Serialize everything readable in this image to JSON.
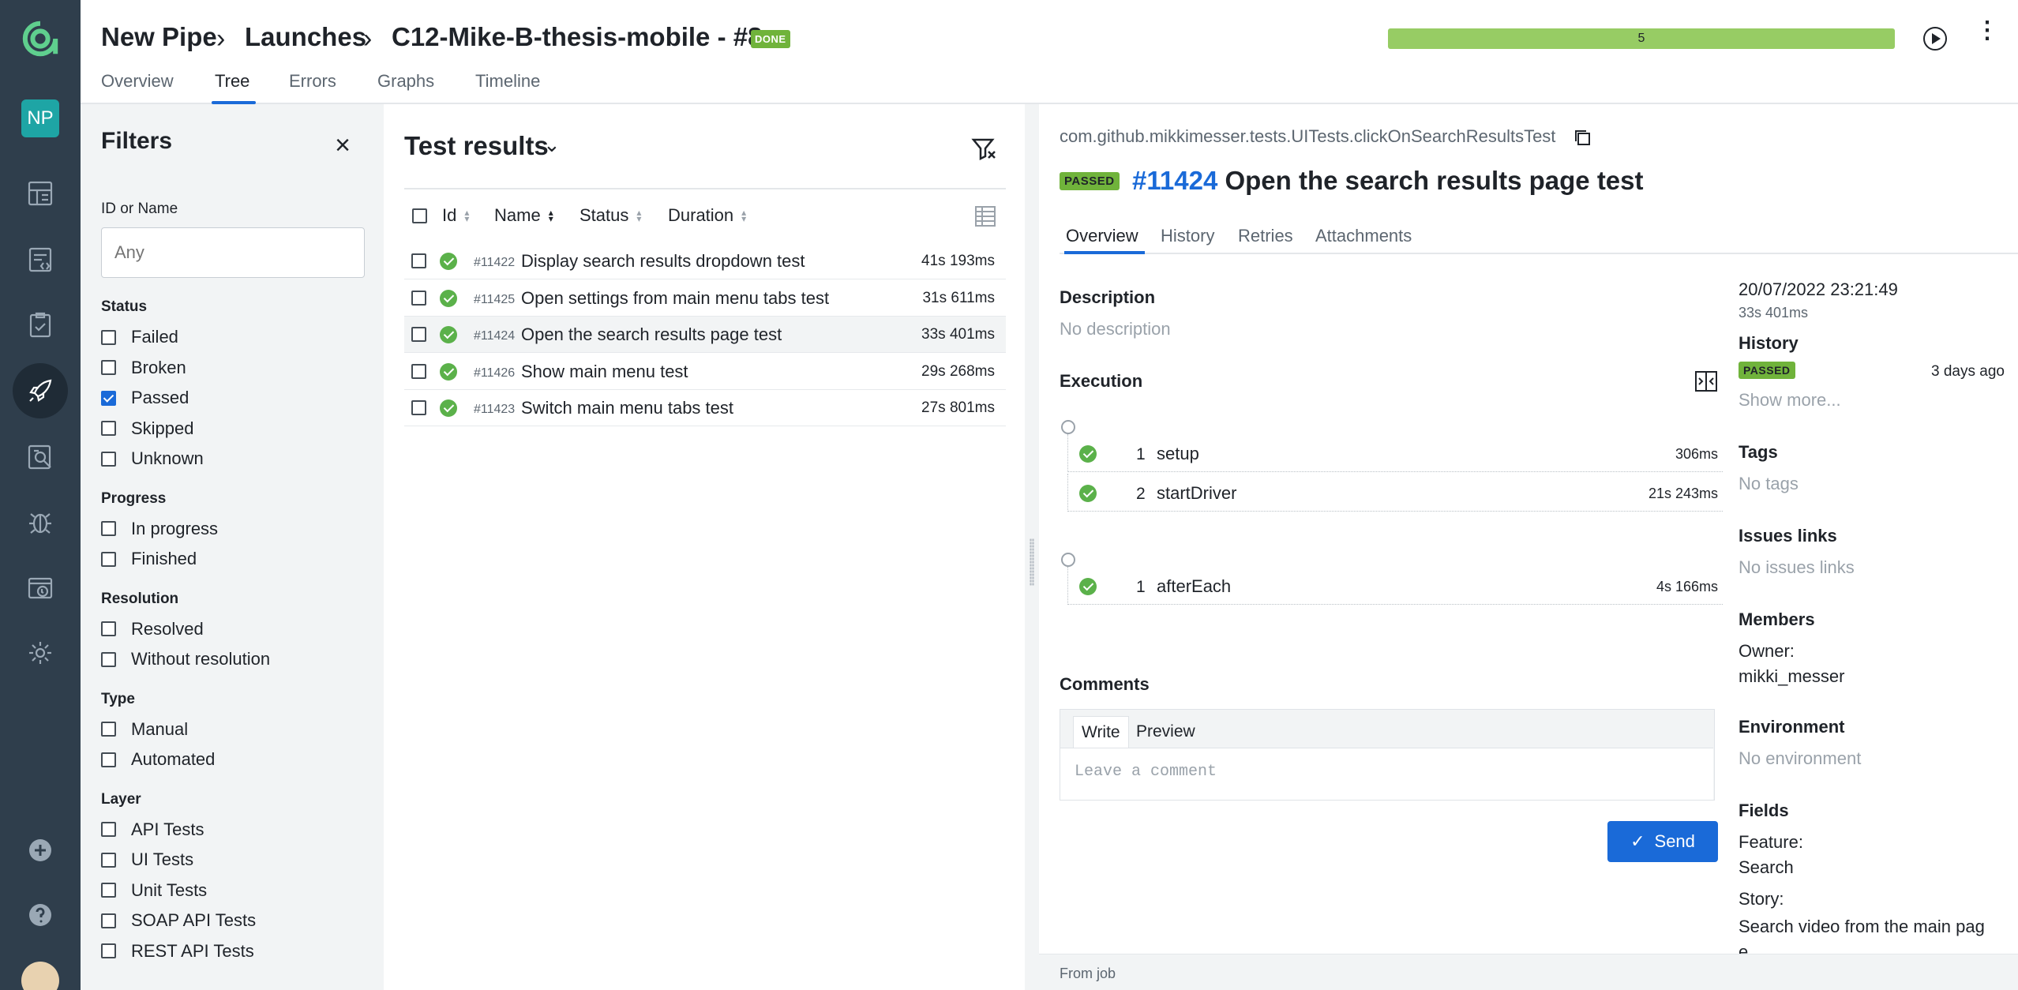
{
  "rail": {
    "badge": "NP",
    "icons": [
      "allure-logo-icon",
      "dashboards-icon",
      "test-cases-icon",
      "test-plans-icon",
      "launches-icon",
      "analytics-icon",
      "defects-icon",
      "jobs-icon",
      "settings-icon",
      "add-icon",
      "help-icon",
      "avatar"
    ]
  },
  "header": {
    "breadcrumbs": [
      "New Pipe",
      "Launches",
      "C12-Mike-B-thesis-mobile - #8"
    ],
    "status_badge": "DONE",
    "progress_value": "5",
    "progress_fraction": 1.0,
    "tabs": [
      "Overview",
      "Tree",
      "Errors",
      "Graphs",
      "Timeline"
    ],
    "active_tab": "Tree"
  },
  "filters": {
    "title": "Filters",
    "id_label": "ID or Name",
    "id_placeholder": "Any",
    "groups": [
      {
        "label": "Status",
        "items": [
          {
            "label": "Failed",
            "checked": false
          },
          {
            "label": "Broken",
            "checked": false
          },
          {
            "label": "Passed",
            "checked": true
          },
          {
            "label": "Skipped",
            "checked": false
          },
          {
            "label": "Unknown",
            "checked": false
          }
        ]
      },
      {
        "label": "Progress",
        "items": [
          {
            "label": "In progress",
            "checked": false
          },
          {
            "label": "Finished",
            "checked": false
          }
        ]
      },
      {
        "label": "Resolution",
        "items": [
          {
            "label": "Resolved",
            "checked": false
          },
          {
            "label": "Without resolution",
            "checked": false
          }
        ]
      },
      {
        "label": "Type",
        "items": [
          {
            "label": "Manual",
            "checked": false
          },
          {
            "label": "Automated",
            "checked": false
          }
        ]
      },
      {
        "label": "Layer",
        "items": [
          {
            "label": "API Tests",
            "checked": false
          },
          {
            "label": "UI Tests",
            "checked": false
          },
          {
            "label": "Unit Tests",
            "checked": false
          },
          {
            "label": "SOAP API Tests",
            "checked": false
          },
          {
            "label": "REST API Tests",
            "checked": false
          }
        ]
      }
    ]
  },
  "results": {
    "title": "Test results",
    "columns": [
      "Id",
      "Name",
      "Status",
      "Duration"
    ],
    "rows": [
      {
        "id": "#11422",
        "name": "Display search results dropdown test",
        "duration": "41s 193ms",
        "status": "passed"
      },
      {
        "id": "#11425",
        "name": "Open settings from main menu tabs test",
        "duration": "31s 611ms",
        "status": "passed"
      },
      {
        "id": "#11424",
        "name": "Open the search results page test",
        "duration": "33s 401ms",
        "status": "passed",
        "selected": true
      },
      {
        "id": "#11426",
        "name": "Show main menu test",
        "duration": "29s 268ms",
        "status": "passed"
      },
      {
        "id": "#11423",
        "name": "Switch main menu tabs test",
        "duration": "27s 801ms",
        "status": "passed"
      }
    ]
  },
  "detail": {
    "path": "com.github.mikkimesser.tests.UITests.clickOnSearchResultsTest",
    "status_badge": "PASSED",
    "test_id": "#11424",
    "test_name": "Open the search results page test",
    "tabs": [
      "Overview",
      "History",
      "Retries",
      "Attachments"
    ],
    "description_label": "Description",
    "description_value": "No description",
    "execution_label": "Execution",
    "setup_steps": [
      {
        "num": "1",
        "name": "setup",
        "duration": "306ms"
      },
      {
        "num": "2",
        "name": "startDriver",
        "duration": "21s 243ms"
      }
    ],
    "teardown_steps": [
      {
        "num": "1",
        "name": "afterEach",
        "duration": "4s 166ms"
      }
    ],
    "comments_label": "Comments",
    "comment_tabs": [
      "Write",
      "Preview"
    ],
    "comment_placeholder": "Leave a comment",
    "send_label": "Send",
    "footer_text": "From job",
    "side": {
      "date": "20/07/2022 23:21:49",
      "duration": "33s 401ms",
      "history_label": "History",
      "history_badge": "PASSED",
      "history_when": "3 days ago",
      "show_more": "Show more...",
      "tags_label": "Tags",
      "tags_value": "No tags",
      "issues_label": "Issues links",
      "issues_value": "No issues links",
      "members_label": "Members",
      "owner_label": "Owner:",
      "owner_value": "mikki_messer",
      "env_label": "Environment",
      "env_value": "No environment",
      "fields_label": "Fields",
      "feature_label": "Feature:",
      "feature_value": "Search",
      "story_label": "Story:",
      "story_value": "Search video from the main pag e"
    }
  }
}
